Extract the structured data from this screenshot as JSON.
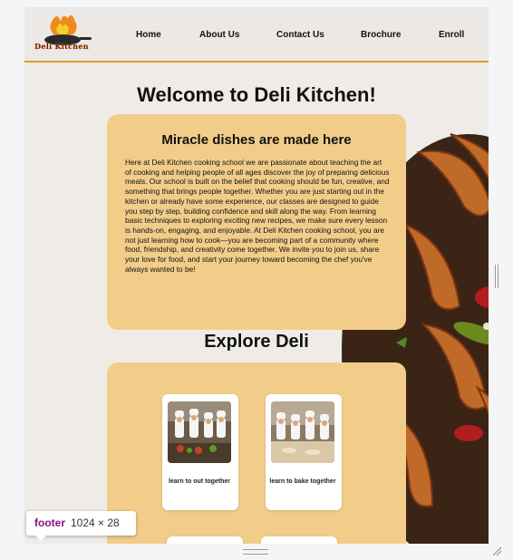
{
  "brand": {
    "logo_text": "Deli Kitchen"
  },
  "nav": {
    "items": [
      {
        "label": "Home"
      },
      {
        "label": "About Us"
      },
      {
        "label": "Contact Us"
      },
      {
        "label": "Brochure"
      },
      {
        "label": "Enroll"
      }
    ]
  },
  "hero": {
    "title": "Welcome to Deli Kitchen!"
  },
  "about": {
    "heading": "Miracle dishes are made here",
    "body": "Here at Deli Kitchen cooking school we are passionate about teaching the art of cooking and helping people of all ages discover the joy of preparing delicious meals. Our school is built on the belief that cooking should be fun, creative, and something that brings people together. Whether you are just starting out in the kitchen or already have some experience, our classes are designed to guide you step by step, building confidence and skill along the way. From learning basic techniques to exploring exciting new recipes, we make sure every lesson is hands-on, engaging, and enjoyable. At Deli Kitchen cooking school, you are not just learning how to cook—you are becoming part of a community where food, friendship, and creativity come together. We invite you to join us, share your love for food, and start your journey toward becoming the chef you've always wanted to be!"
  },
  "explore": {
    "title": "Explore Deli",
    "tiles": [
      {
        "caption": "learn to out together"
      },
      {
        "caption": "learn to bake together"
      }
    ]
  },
  "devtools": {
    "element_tag": "footer",
    "element_size": "1024 × 28"
  },
  "colors": {
    "accent": "#e39a2a",
    "card": "#f2cd8a",
    "navbar": "#ebe8e5"
  }
}
